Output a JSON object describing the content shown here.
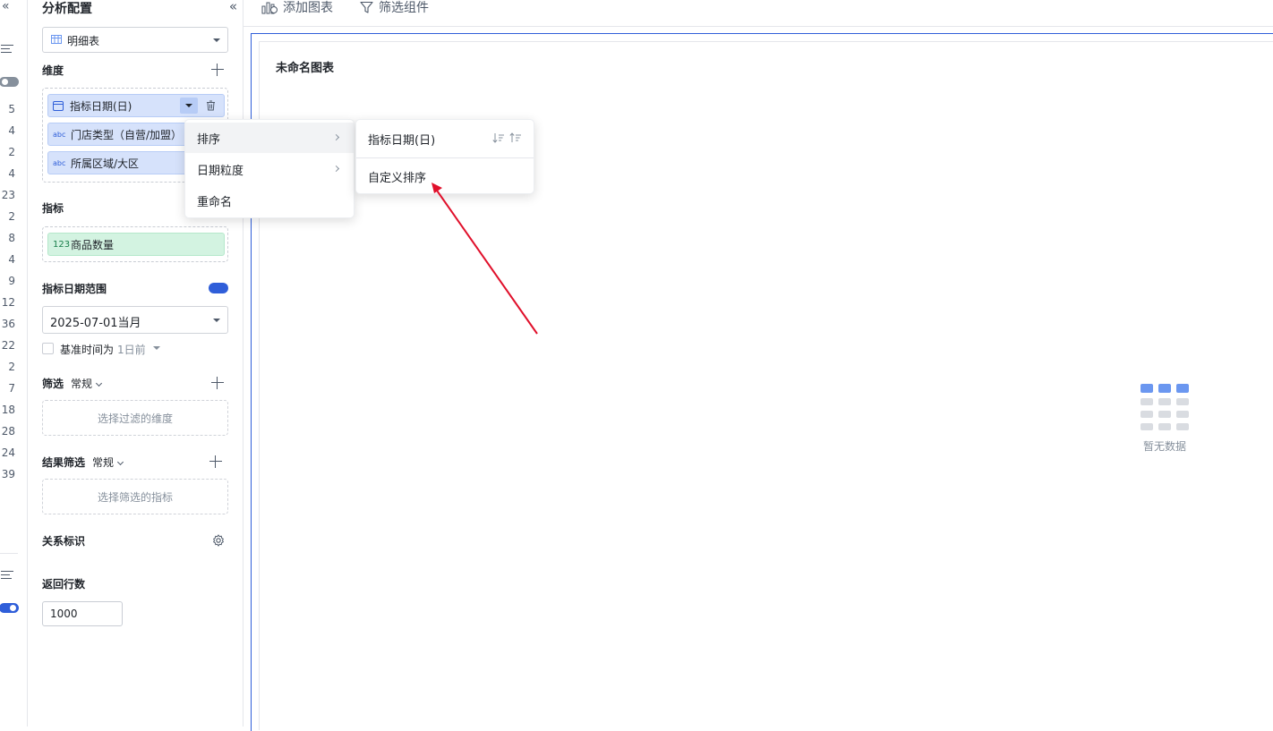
{
  "left_strip": {
    "row_numbers": [
      "5",
      "4",
      "2",
      "4",
      "23",
      "2",
      "8",
      "4",
      "9",
      "12",
      "36",
      "22",
      "2",
      "7",
      "18",
      "28",
      "24",
      "39"
    ]
  },
  "config": {
    "title": "分析配置",
    "chart_type": "明细表",
    "dimensions": {
      "label": "维度",
      "items": [
        {
          "type": "date",
          "label": "指标日期(日)"
        },
        {
          "type": "abc",
          "label": "门店类型（自营/加盟）"
        },
        {
          "type": "abc",
          "label": "所属区域/大区"
        }
      ]
    },
    "metrics": {
      "label": "指标",
      "items": [
        {
          "type": "123",
          "label": "商品数量"
        }
      ]
    },
    "date_range": {
      "label": "指标日期范围",
      "enabled": true,
      "value": "2025-07-01当月",
      "base_time_label": "基准时间为",
      "base_time_value": "1日前"
    },
    "filter": {
      "label": "筛选",
      "mode": "常规",
      "placeholder": "选择过滤的维度"
    },
    "result_filter": {
      "label": "结果筛选",
      "mode": "常规",
      "placeholder": "选择筛选的指标"
    },
    "relation_label": "关系标识",
    "row_limit": {
      "label": "返回行数",
      "value": "1000"
    }
  },
  "toolbar": {
    "add_chart": "添加图表",
    "filter_component": "筛选组件"
  },
  "canvas": {
    "chart_title": "未命名图表",
    "empty_text": "暂无数据"
  },
  "context_menu": {
    "items": [
      "排序",
      "日期粒度",
      "重命名"
    ]
  },
  "sort_submenu": {
    "field": "指标日期(日)",
    "custom_sort": "自定义排序"
  },
  "colors": {
    "accent": "#2f5ed9",
    "dimension_pill": "#d6e2fb",
    "metric_pill": "#d3f3e1",
    "annotation_arrow": "#e0102b"
  }
}
